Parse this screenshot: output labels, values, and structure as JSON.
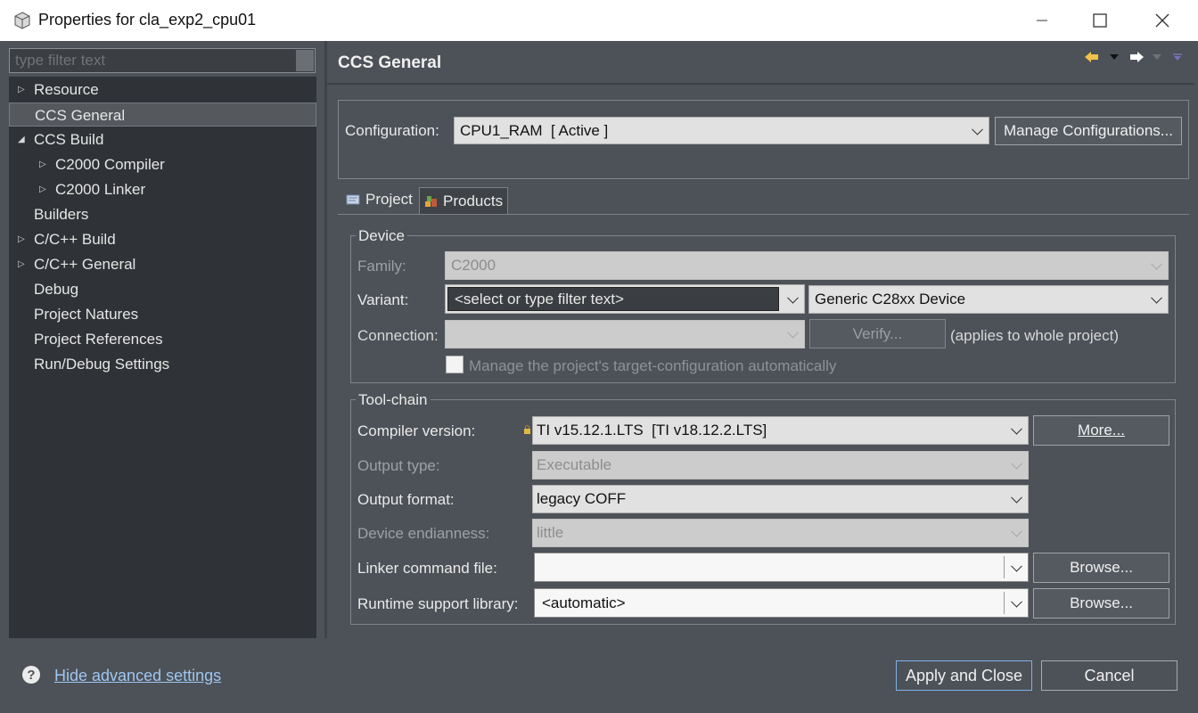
{
  "window": {
    "title": "Properties for cla_exp2_cpu01"
  },
  "sidebar": {
    "filter_placeholder": "type filter text",
    "items": [
      {
        "label": "Resource",
        "twisty": "collapsed"
      },
      {
        "label": "CCS General",
        "selected": true
      },
      {
        "label": "CCS Build",
        "twisty": "expanded"
      },
      {
        "label": "C2000 Compiler",
        "twisty": "collapsed",
        "child": true
      },
      {
        "label": "C2000 Linker",
        "twisty": "collapsed",
        "child": true
      },
      {
        "label": "Builders"
      },
      {
        "label": "C/C++ Build",
        "twisty": "collapsed"
      },
      {
        "label": "C/C++ General",
        "twisty": "collapsed"
      },
      {
        "label": "Debug"
      },
      {
        "label": "Project Natures"
      },
      {
        "label": "Project References"
      },
      {
        "label": "Run/Debug Settings"
      }
    ]
  },
  "page": {
    "title": "CCS General",
    "configuration_label": "Configuration:",
    "configuration_value": "CPU1_RAM  [ Active ]",
    "manage_button": "Manage Configurations..."
  },
  "tabs": [
    {
      "label": "Project",
      "active": true
    },
    {
      "label": "Products",
      "active": false
    }
  ],
  "device": {
    "group_label": "Device",
    "family_label": "Family:",
    "family_value": "C2000",
    "variant_label": "Variant:",
    "variant_filter": "<select or type filter text>",
    "variant_value": "Generic C28xx Device",
    "connection_label": "Connection:",
    "connection_value": "",
    "verify_button": "Verify...",
    "applies_text": "(applies to whole project)",
    "manage_checkbox": "Manage the project's target-configuration automatically"
  },
  "toolchain": {
    "group_label": "Tool-chain",
    "compiler_label": "Compiler version:",
    "compiler_value": "TI v15.12.1.LTS  [TI v18.12.2.LTS]",
    "more_button": "More...",
    "output_type_label": "Output type:",
    "output_type_value": "Executable",
    "output_format_label": "Output format:",
    "output_format_value": "legacy COFF",
    "endianness_label": "Device endianness:",
    "endianness_value": "little",
    "linker_label": "Linker command file:",
    "linker_value": "",
    "browse_button": "Browse...",
    "runtime_label": "Runtime support library:",
    "runtime_value": "<automatic>"
  },
  "footer": {
    "help_glyph": "?",
    "advanced_link": "Hide advanced settings",
    "apply_close_button": "Apply and Close",
    "cancel_button": "Cancel"
  },
  "colors": {
    "background": "#4d5258",
    "tree_background": "#2f3236",
    "link": "#9fc6ef",
    "default_button_border": "#7db2e8"
  }
}
